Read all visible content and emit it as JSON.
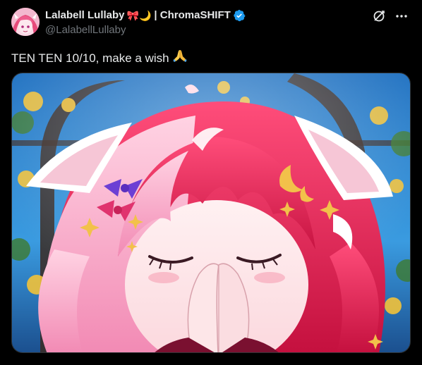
{
  "tweet": {
    "display_name": "Lalabell Lullaby",
    "name_emojis": "🎀🌙",
    "name_suffix": "| ChromaSHIFT",
    "handle": "@LalabellLullaby",
    "text": "TEN TEN 10/10, make a wish",
    "text_emoji": "pray-icon"
  },
  "icons": {
    "verified": "verified-badge-icon",
    "grok": "grok-icon",
    "more": "more-icon"
  },
  "colors": {
    "background": "#000000",
    "text_primary": "#e7e9ea",
    "text_secondary": "#71767b",
    "verified_blue": "#1d9bf0"
  }
}
